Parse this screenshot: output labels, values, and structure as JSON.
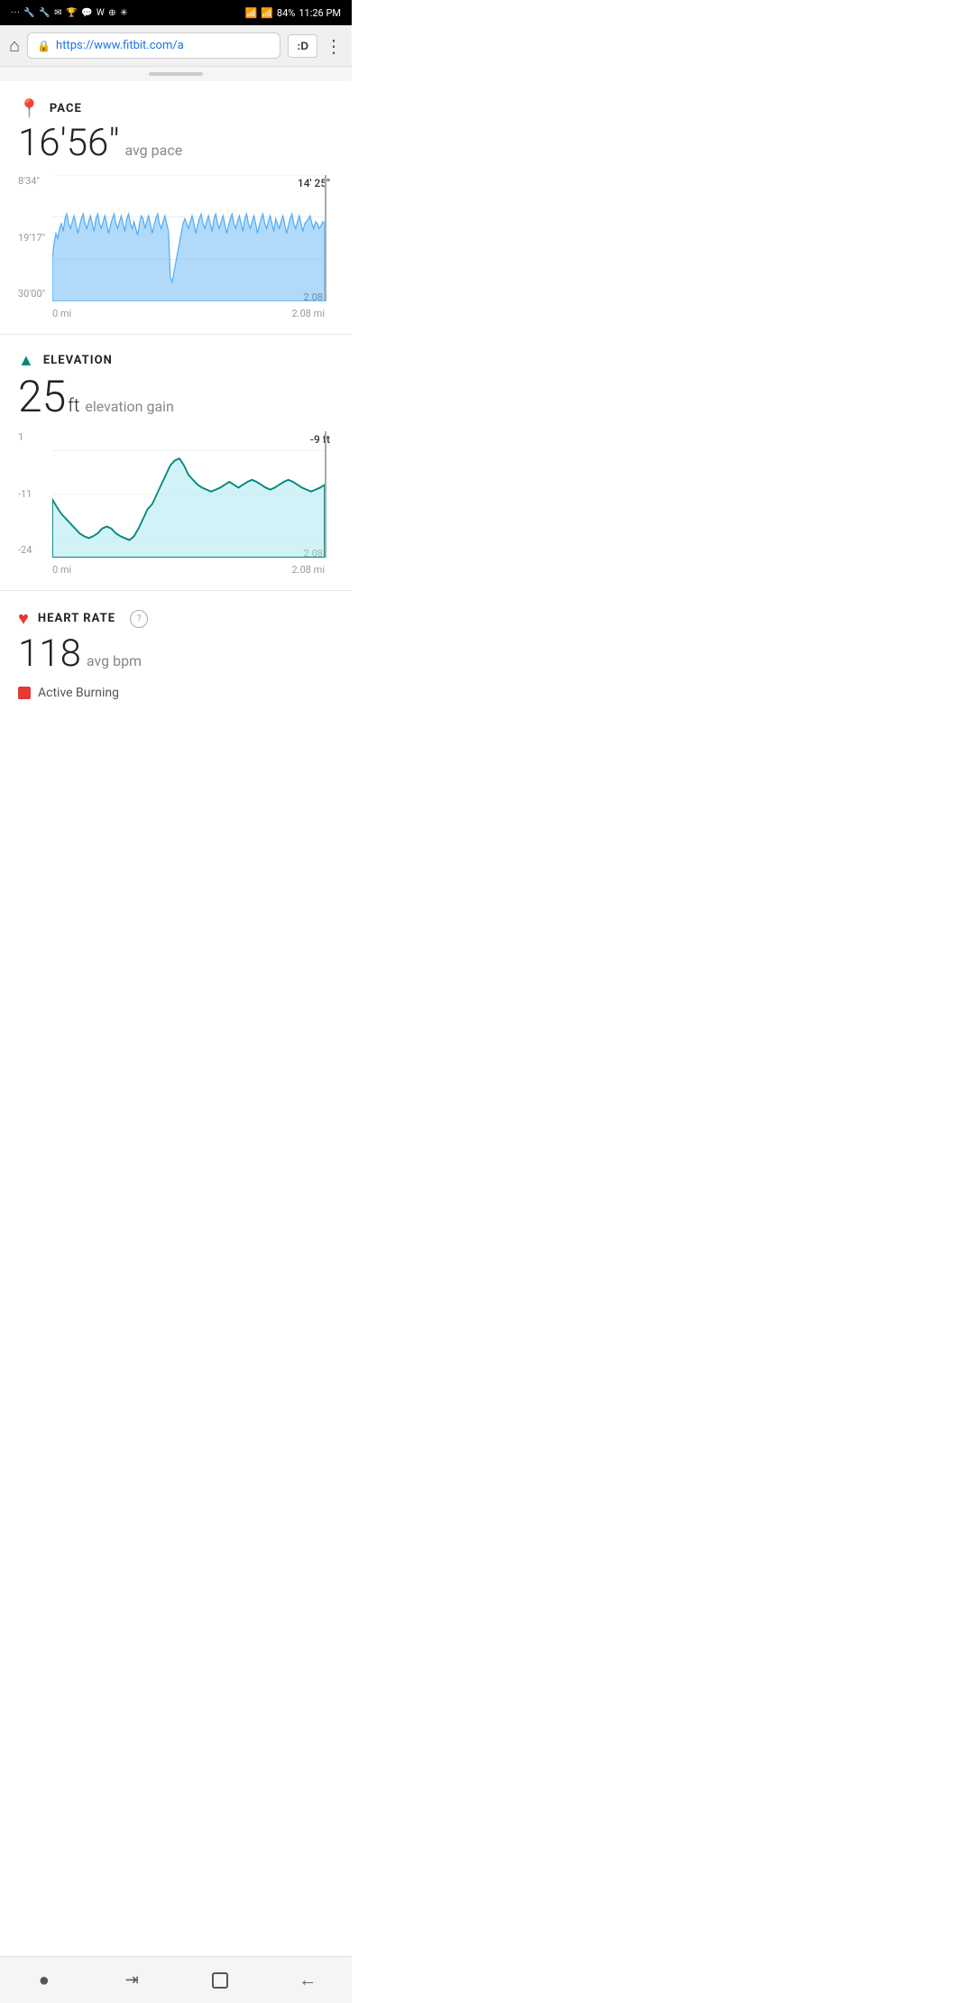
{
  "status_bar": {
    "left_icons": "··· ⊡ ⊡ M ♛ ✉ W ⊕ ✴",
    "battery": "84%",
    "time": "11:26 PM"
  },
  "browser": {
    "url": "https://www.fitbit.com/a",
    "tab_btn": ":D",
    "home_label": "home"
  },
  "pace": {
    "section_title": "PACE",
    "value": "16'56\"",
    "value_main": "16'56\"",
    "unit": "avg pace",
    "chart_tooltip": "14' 25\"",
    "chart_right_value": "2.08",
    "y_labels": [
      "8'34\"",
      "19'17\"",
      "30'00\""
    ],
    "x_labels": [
      "0 mi",
      "2.08 mi"
    ]
  },
  "elevation": {
    "section_title": "ELEVATION",
    "value": "25",
    "unit": "ft",
    "subunit": "elevation gain",
    "chart_tooltip": "-9 ft",
    "chart_right_value": "2.08",
    "y_labels": [
      "1",
      "-11",
      "-24"
    ],
    "x_labels": [
      "0 mi",
      "2.08 mi"
    ]
  },
  "heart_rate": {
    "section_title": "HEART RATE",
    "help_label": "?",
    "value": "118",
    "unit": "avg bpm",
    "badge_label": "Active Burning"
  },
  "bottom_nav": {
    "dot_btn": "●",
    "tabs_btn": "⇥",
    "square_btn": "□",
    "back_btn": "←"
  }
}
